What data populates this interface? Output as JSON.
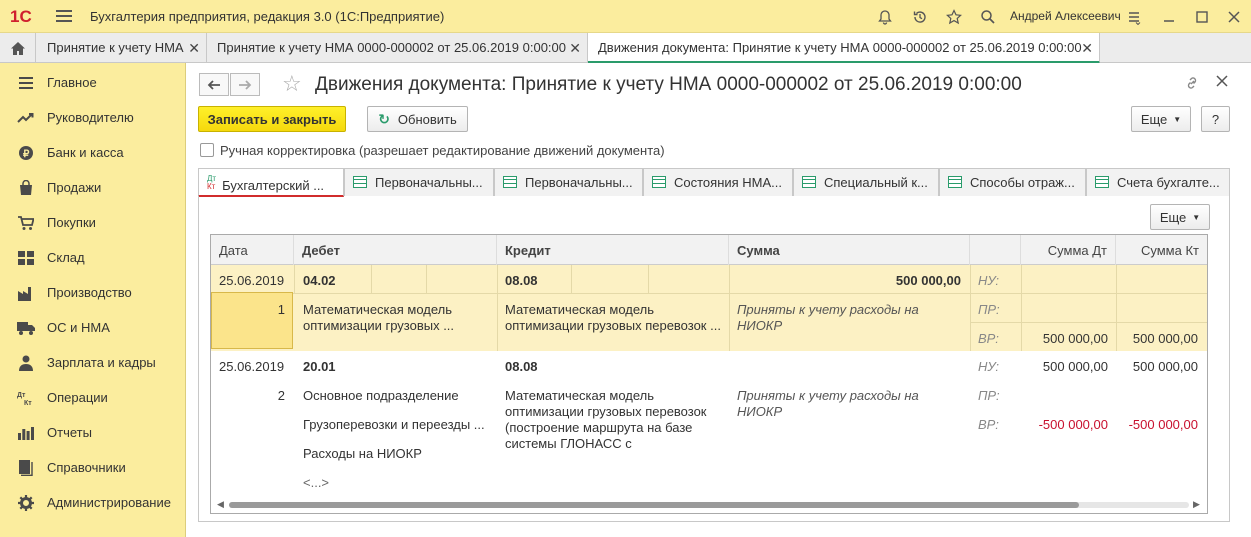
{
  "app": {
    "logo_text": "1С",
    "title": "Бухгалтерия предприятия, редакция 3.0  (1С:Предприятие)",
    "user": "Андрей Алексеевич"
  },
  "window_tabs": [
    {
      "label": "Принятие к учету НМА",
      "active": false
    },
    {
      "label": "Принятие к учету НМА 0000-000002 от 25.06.2019 0:00:00",
      "active": false
    },
    {
      "label": "Движения документа: Принятие к учету НМА 0000-000002 от 25.06.2019 0:00:00",
      "active": true
    }
  ],
  "sidebar": {
    "items": [
      {
        "label": "Главное",
        "icon": "menu-icon"
      },
      {
        "label": "Руководителю",
        "icon": "trend-icon"
      },
      {
        "label": "Банк и касса",
        "icon": "coin-icon"
      },
      {
        "label": "Продажи",
        "icon": "bag-icon"
      },
      {
        "label": "Покупки",
        "icon": "cart-icon"
      },
      {
        "label": "Склад",
        "icon": "warehouse-icon"
      },
      {
        "label": "Производство",
        "icon": "factory-icon"
      },
      {
        "label": "ОС и НМА",
        "icon": "truck-icon"
      },
      {
        "label": "Зарплата и кадры",
        "icon": "person-icon"
      },
      {
        "label": "Операции",
        "icon": "dt-kt-icon"
      },
      {
        "label": "Отчеты",
        "icon": "bar-chart-icon"
      },
      {
        "label": "Справочники",
        "icon": "book-icon"
      },
      {
        "label": "Администрирование",
        "icon": "gear-icon"
      }
    ]
  },
  "document": {
    "title": "Движения документа: Принятие к учету НМА 0000-000002 от 25.06.2019 0:00:00",
    "save_close_label": "Записать и закрыть",
    "refresh_label": "Обновить",
    "more_label": "Еще",
    "help_label": "?",
    "manual_correction_label": "Ручная корректировка (разрешает редактирование движений документа)",
    "manual_correction_checked": false
  },
  "inner_tabs": [
    {
      "label": "Бухгалтерский ...",
      "icon": "dt-kt-icon",
      "active": true
    },
    {
      "label": "Первоначальны...",
      "icon": "table-icon",
      "active": false
    },
    {
      "label": "Первоначальны...",
      "icon": "table-icon",
      "active": false
    },
    {
      "label": "Состояния НМА...",
      "icon": "table-icon",
      "active": false
    },
    {
      "label": "Специальный к...",
      "icon": "table-icon",
      "active": false
    },
    {
      "label": "Способы отраж...",
      "icon": "table-icon",
      "active": false
    },
    {
      "label": "Счета бухгалте...",
      "icon": "table-icon",
      "active": false
    }
  ],
  "grid_more_label": "Еще",
  "grid": {
    "columns": [
      "Дата",
      "Дебет",
      "Кредит",
      "Сумма",
      "",
      "Сумма Дт",
      "Сумма Кт"
    ],
    "rows": [
      {
        "date": "25.06.2019",
        "num": "1",
        "debit_account": "04.02",
        "debit_sub": [
          "Математическая модель оптимизации грузовых ..."
        ],
        "credit_account": "08.08",
        "credit_sub": "Математическая модель оптимизации грузовых перевозок ...",
        "amount": "500 000,00",
        "content": "Приняты к учету расходы на НИОКР",
        "nu_label": "НУ:",
        "pr_label": "ПР:",
        "vr_label": "ВР:",
        "nu_dt": "",
        "nu_kt": "",
        "pr_dt": "",
        "pr_kt": "",
        "vr_dt": "500 000,00",
        "vr_kt": "500 000,00",
        "selected": true
      },
      {
        "date": "25.06.2019",
        "num": "2",
        "debit_account": "20.01",
        "debit_sub": [
          "Основное подразделение",
          "Грузоперевозки и переезды ...",
          "Расходы на НИОКР",
          "<...>"
        ],
        "credit_account": "08.08",
        "credit_sub": "Математическая модель оптимизации грузовых перевозок (построение маршрута на базе системы ГЛОНАСС с",
        "amount": "",
        "content": "Приняты к учету расходы на НИОКР",
        "nu_label": "НУ:",
        "pr_label": "ПР:",
        "vr_label": "ВР:",
        "nu_dt": "500 000,00",
        "nu_kt": "500 000,00",
        "pr_dt": "",
        "pr_kt": "",
        "vr_dt": "-500 000,00",
        "vr_kt": "-500 000,00",
        "selected": false
      }
    ]
  },
  "colors": {
    "panel_yellow": "#fbed9e",
    "primary_button": "#f5d90d",
    "accent_green": "#2a9b6b",
    "negative_red": "#c8102e",
    "selected_row": "#fcf1c4"
  }
}
